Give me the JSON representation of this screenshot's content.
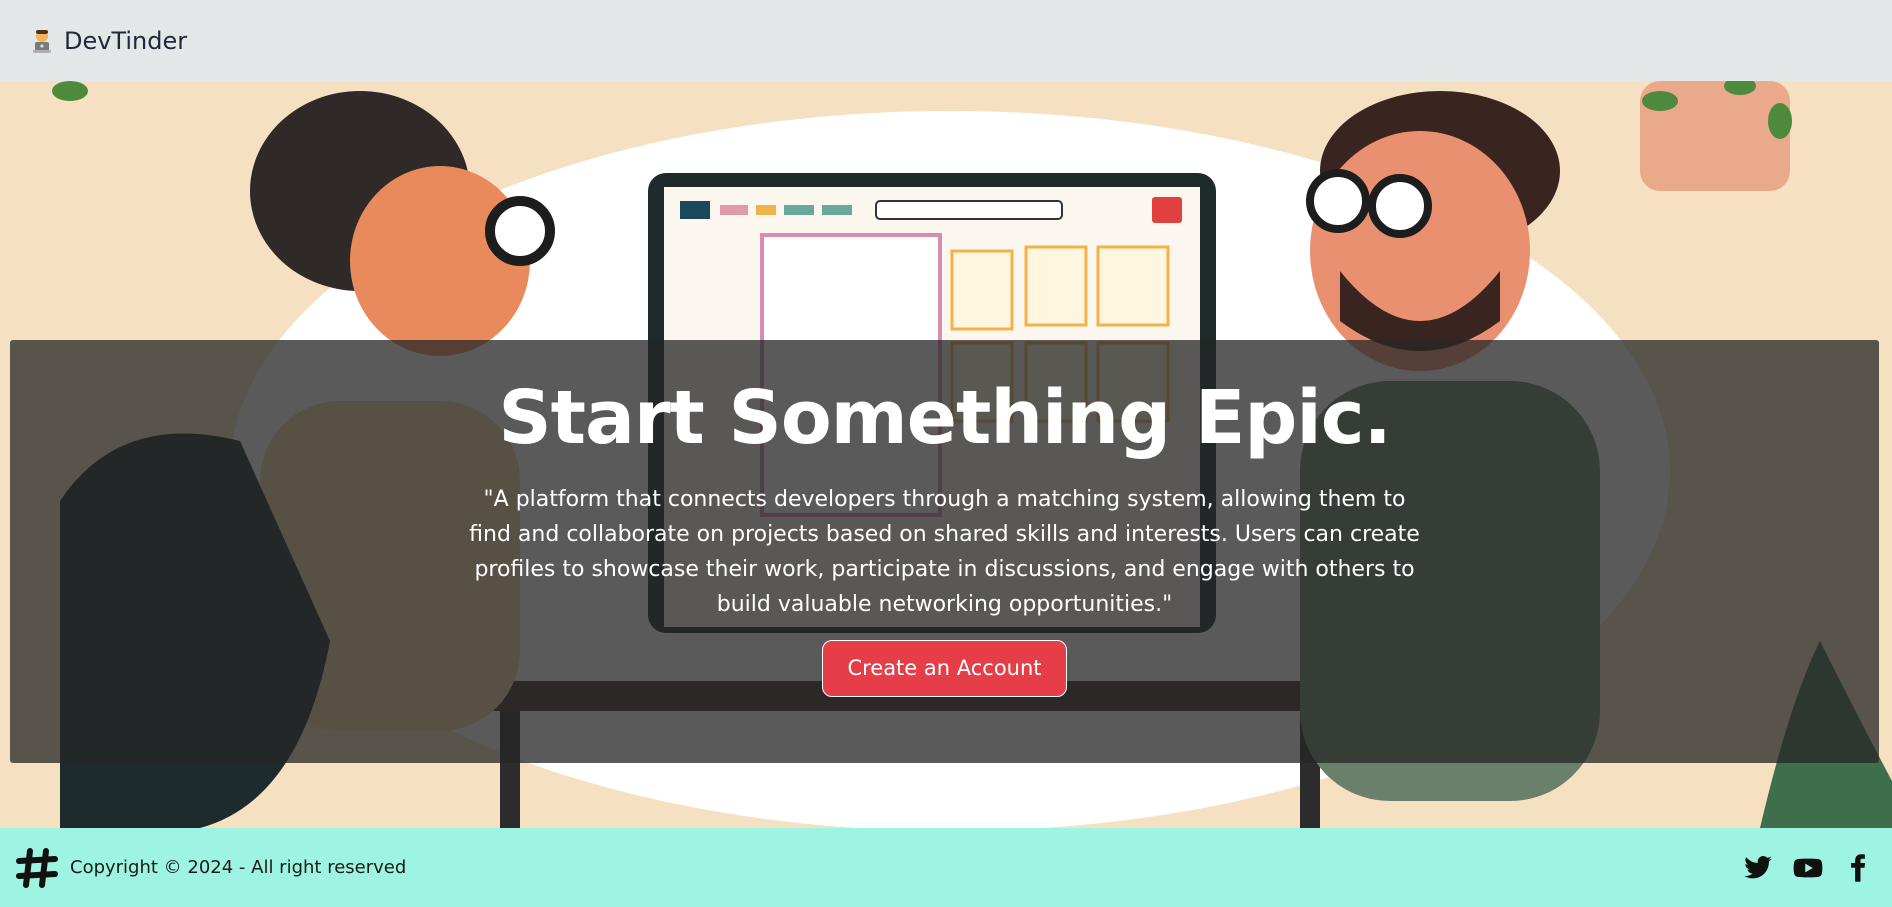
{
  "navbar": {
    "brand_icon": "developer-laptop-icon",
    "brand_label": "DevTinder"
  },
  "hero": {
    "background": "developers-collaborating-illustration",
    "title": "Start Something Epic.",
    "description": "\"A platform that connects developers through a matching system, allowing them to find and collaborate on projects based on shared skills and interests. Users can create profiles to showcase their work, participate in discussions, and engage with others to build valuable networking opportunities.\"",
    "cta_label": "Create an Account",
    "cta_color": "#e53e48",
    "overlay_color": "#262626"
  },
  "footer": {
    "logo_icon": "hashtag-icon",
    "copyright": "Copyright © 2024 - All right reserved",
    "background": "#9df4e2",
    "socials": [
      {
        "name": "twitter-icon"
      },
      {
        "name": "youtube-icon"
      },
      {
        "name": "facebook-icon"
      }
    ]
  }
}
